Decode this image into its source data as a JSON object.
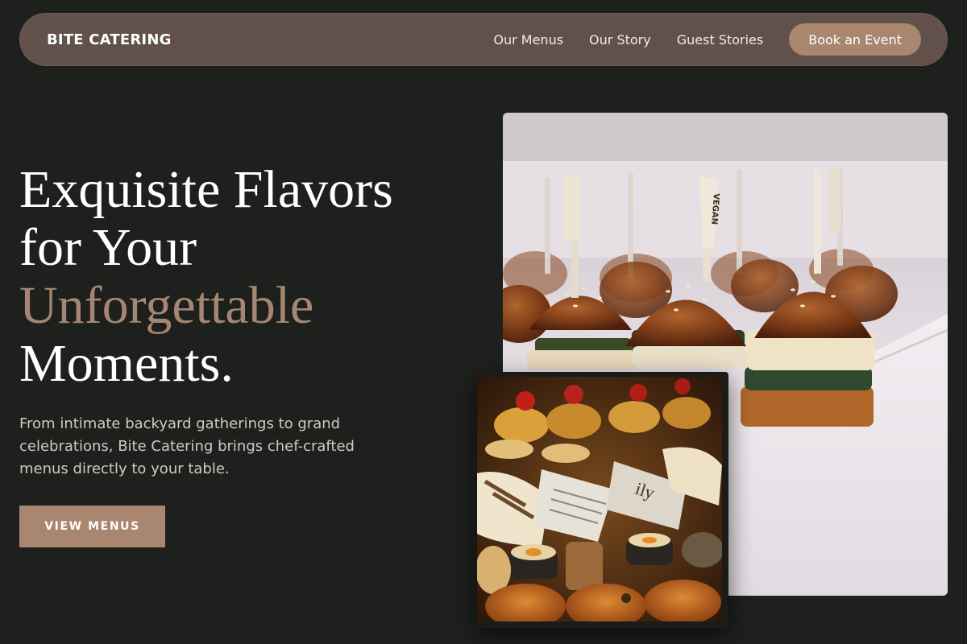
{
  "nav": {
    "brand": "BITE CATERING",
    "links": [
      "Our Menus",
      "Our Story",
      "Guest Stories"
    ],
    "cta": "Book an Event"
  },
  "hero": {
    "title_line1": "Exquisite Flavors",
    "title_line2": "for Your",
    "title_accent": "Unforgettable",
    "title_line4": "Moments.",
    "description": "From intimate backyard gatherings to grand celebrations, Bite Catering brings chef-crafted menus directly to your table.",
    "button": "VIEW MENUS"
  },
  "images": {
    "main_flag_text": "VEGAN"
  },
  "colors": {
    "background": "#1d201c",
    "nav": "#62514a",
    "accent": "#a98670",
    "accent_text": "#a58672"
  }
}
